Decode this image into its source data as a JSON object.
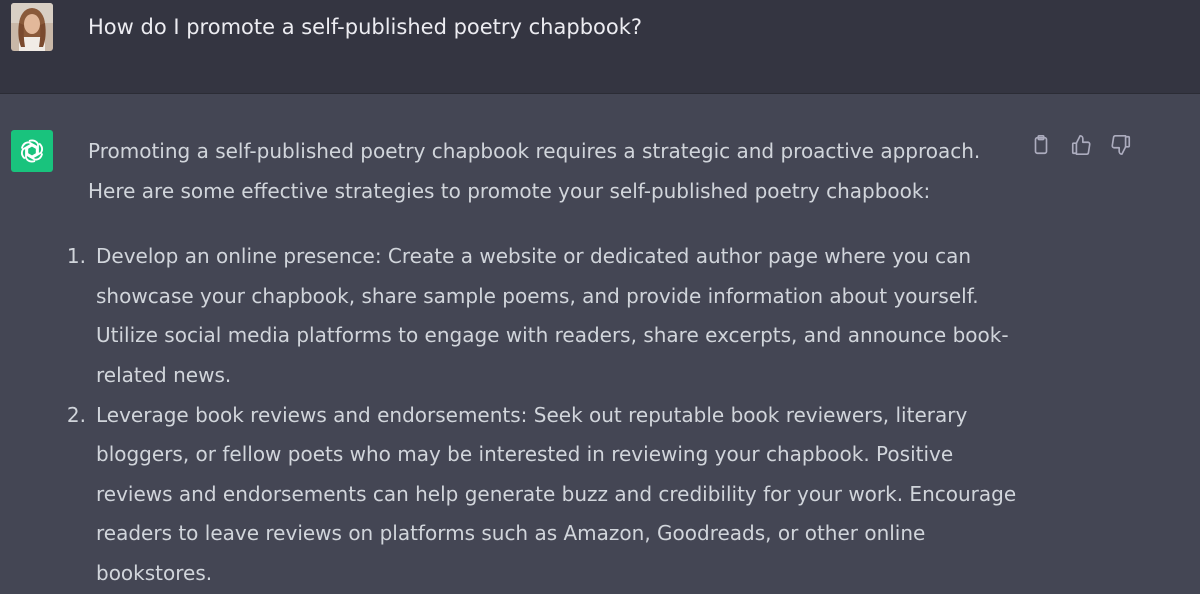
{
  "user_message": {
    "text": "How do I promote a self-published poetry chapbook?"
  },
  "assistant_message": {
    "intro_line1": "Promoting a self-published poetry chapbook requires a strategic and proactive approach.",
    "intro_line2": "Here are some effective strategies to promote your self-published poetry chapbook:",
    "items": [
      {
        "number": "1.",
        "lines": [
          "Develop an online presence: Create a website or dedicated author page where you can",
          "showcase your chapbook, share sample poems, and provide information about yourself.",
          "Utilize social media platforms to engage with readers, share excerpts, and announce book-",
          "related news."
        ]
      },
      {
        "number": "2.",
        "lines": [
          "Leverage book reviews and endorsements: Seek out reputable book reviewers, literary",
          "bloggers, or fellow poets who may be interested in reviewing your chapbook. Positive",
          "reviews and endorsements can help generate buzz and credibility for your work. Encourage",
          "readers to leave reviews on platforms such as Amazon, Goodreads, or other online",
          "bookstores."
        ]
      }
    ]
  },
  "actions": {
    "copy_icon": "clipboard-icon",
    "like_icon": "thumbs-up-icon",
    "dislike_icon": "thumbs-down-icon"
  },
  "colors": {
    "user_bg": "#343541",
    "assistant_bg": "#444654",
    "gpt_accent": "#19c37d",
    "text": "#d1d5db"
  }
}
